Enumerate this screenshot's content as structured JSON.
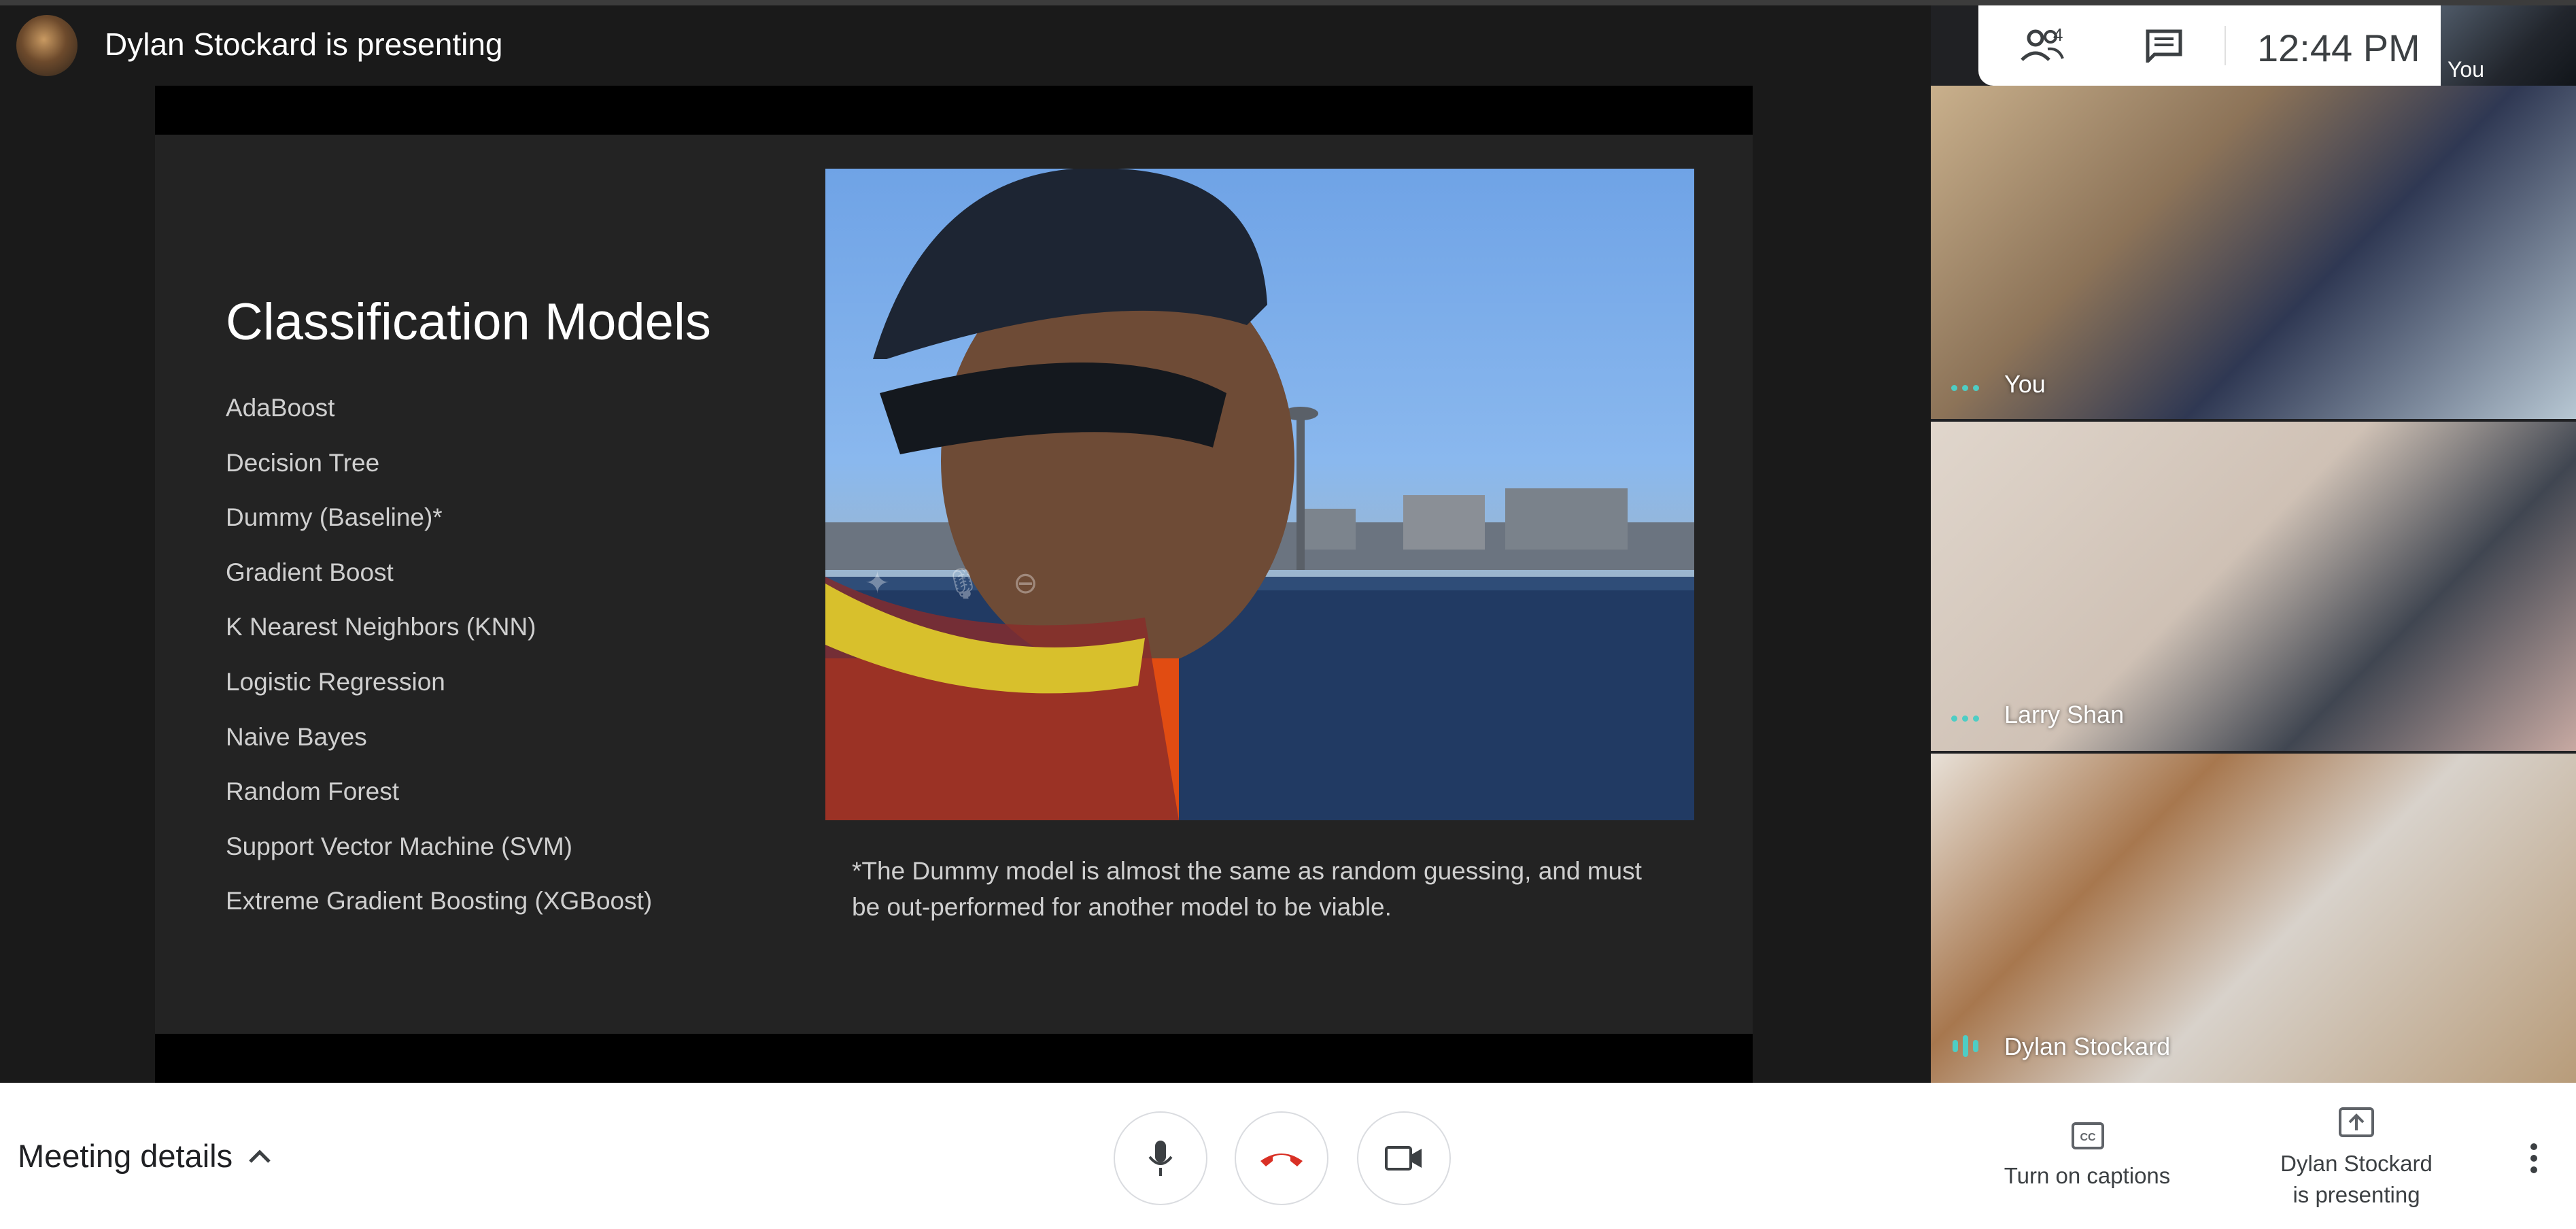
{
  "header": {
    "presenting_text": "Dylan Stockard is presenting",
    "participants_count": "4",
    "time": "12:44 PM",
    "self_thumb_label": "You"
  },
  "slide": {
    "title": "Classification Models",
    "models": [
      "AdaBoost",
      "Decision Tree",
      "Dummy (Baseline)*",
      "Gradient Boost",
      "K Nearest Neighbors (KNN)",
      "Logistic Regression",
      "Naive Bayes",
      "Random Forest",
      "Support Vector Machine (SVM)",
      "Extreme Gradient Boosting (XGBoost)"
    ],
    "footnote": "*The Dummy model is almost the same as random guessing, and must be out-performed for another model to be viable."
  },
  "participants": [
    {
      "name": "You"
    },
    {
      "name": "Larry Shan"
    },
    {
      "name": "Dylan Stockard"
    }
  ],
  "bottom": {
    "meeting_details": "Meeting details",
    "captions_label": "Turn on captions",
    "presenting_label_line1": "Dylan Stockard",
    "presenting_label_line2": "is presenting"
  },
  "colors": {
    "hangup": "#d93025",
    "active_speaker": "#4ecdc4",
    "slide_bg": "#232323"
  }
}
